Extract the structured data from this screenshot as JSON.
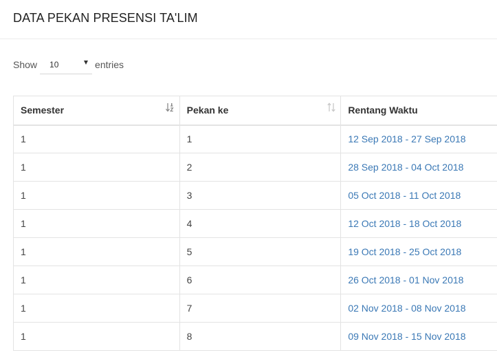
{
  "header": {
    "title": "DATA PEKAN PRESENSI TA'LIM"
  },
  "length": {
    "show_label": "Show",
    "selected": "10",
    "entries_label": "entries"
  },
  "table": {
    "columns": [
      "Semester",
      "Pekan ke",
      "Rentang Waktu"
    ],
    "rows": [
      {
        "semester": "1",
        "pekan": "1",
        "rentang": "12 Sep 2018 - 27 Sep 2018"
      },
      {
        "semester": "1",
        "pekan": "2",
        "rentang": "28 Sep 2018 - 04 Oct 2018"
      },
      {
        "semester": "1",
        "pekan": "3",
        "rentang": "05 Oct 2018 - 11 Oct 2018"
      },
      {
        "semester": "1",
        "pekan": "4",
        "rentang": "12 Oct 2018 - 18 Oct 2018"
      },
      {
        "semester": "1",
        "pekan": "5",
        "rentang": "19 Oct 2018 - 25 Oct 2018"
      },
      {
        "semester": "1",
        "pekan": "6",
        "rentang": "26 Oct 2018 - 01 Nov 2018"
      },
      {
        "semester": "1",
        "pekan": "7",
        "rentang": "02 Nov 2018 - 08 Nov 2018"
      },
      {
        "semester": "1",
        "pekan": "8",
        "rentang": "09 Nov 2018 - 15 Nov 2018"
      }
    ]
  },
  "icons": {
    "semester_sort": "sort-numeric-asc-icon",
    "pekan_sort": "sort-both-icon"
  },
  "colors": {
    "link": "#3a78b5",
    "border": "#e3e3e3"
  }
}
